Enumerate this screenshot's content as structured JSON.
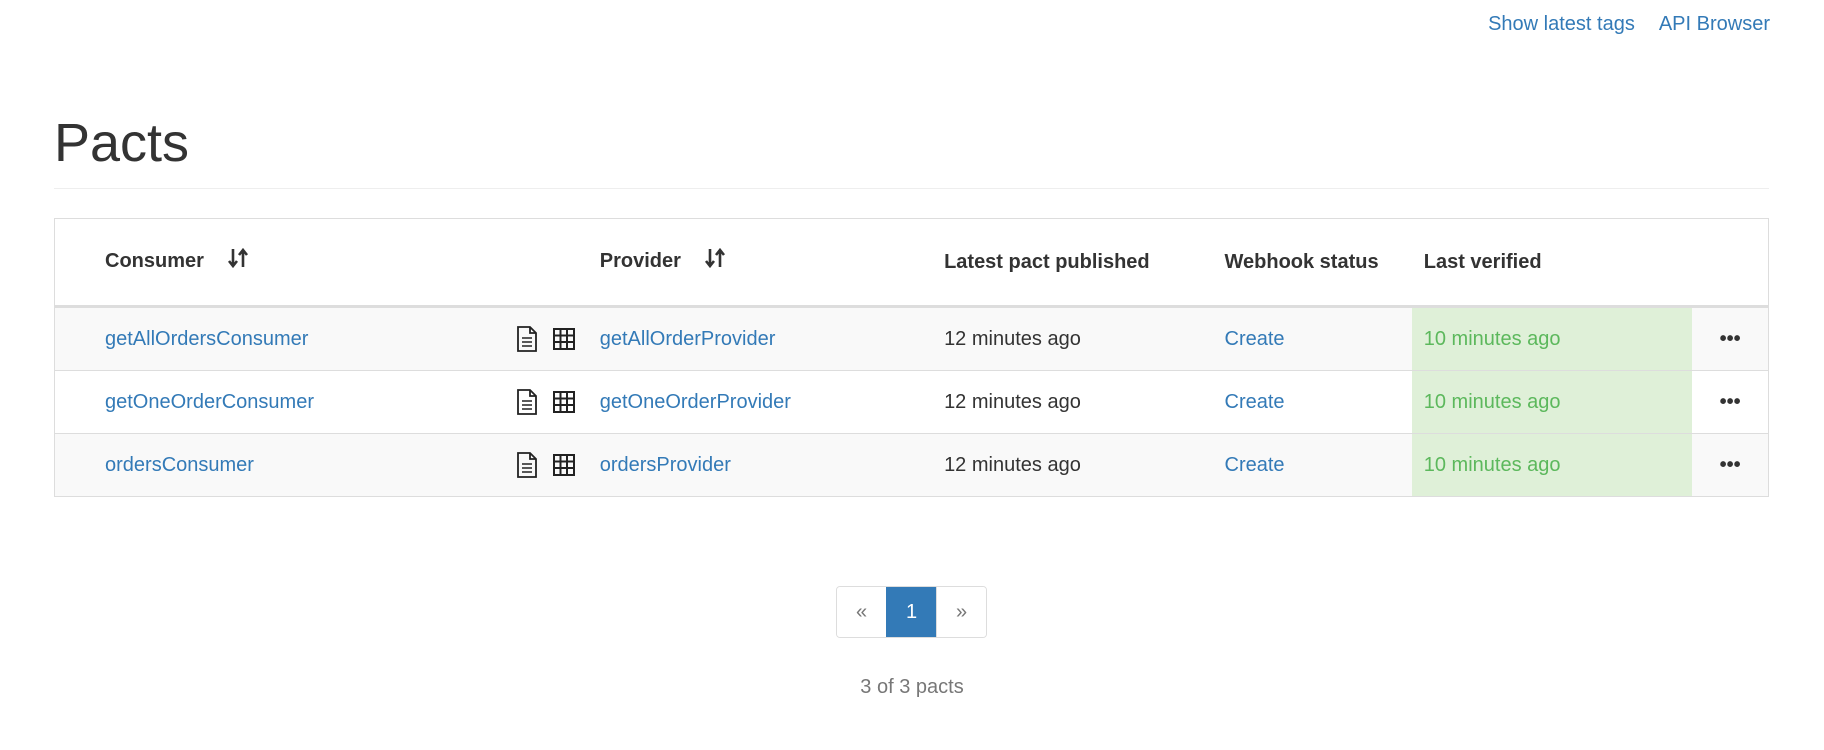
{
  "nav": {
    "links": [
      "Show latest tags",
      "API Browser"
    ]
  },
  "page": {
    "title": "Pacts"
  },
  "table": {
    "headers": {
      "consumer": "Consumer",
      "provider": "Provider",
      "latest_pact_published": "Latest pact published",
      "webhook_status": "Webhook status",
      "last_verified": "Last verified"
    },
    "rows": [
      {
        "consumer": "getAllOrdersConsumer",
        "provider": "getAllOrderProvider",
        "published": "12 minutes ago",
        "webhook": "Create",
        "verified": "10 minutes ago",
        "actions": "•••"
      },
      {
        "consumer": "getOneOrderConsumer",
        "provider": "getOneOrderProvider",
        "published": "12 minutes ago",
        "webhook": "Create",
        "verified": "10 minutes ago",
        "actions": "•••"
      },
      {
        "consumer": "ordersConsumer",
        "provider": "ordersProvider",
        "published": "12 minutes ago",
        "webhook": "Create",
        "verified": "10 minutes ago",
        "actions": "•••"
      }
    ]
  },
  "pagination": {
    "prev": "«",
    "current": "1",
    "next": "»"
  },
  "summary": "3 of 3 pacts",
  "colors": {
    "link": "#337ab7",
    "verified_bg": "#dff0d8",
    "verified_text": "#5cb85c",
    "active_page": "#337ab7"
  }
}
